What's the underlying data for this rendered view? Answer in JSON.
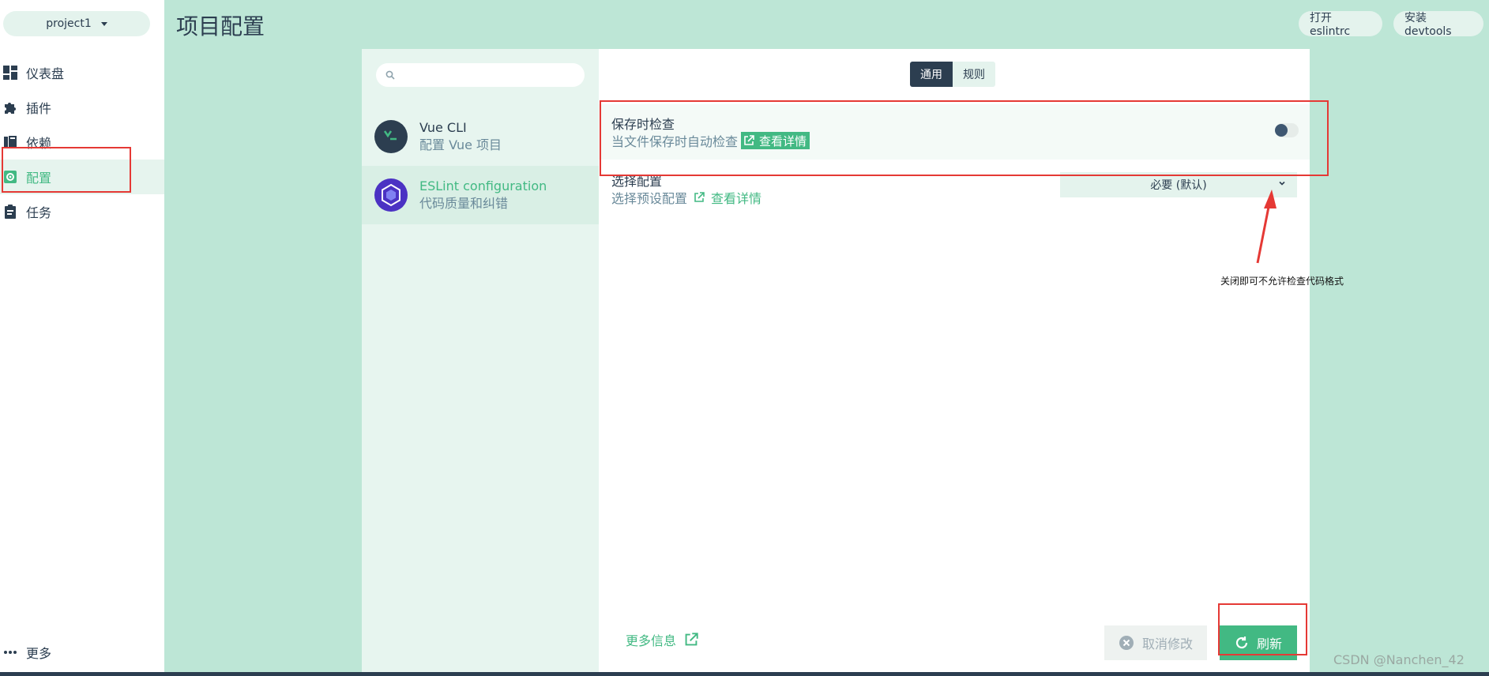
{
  "sidebar": {
    "project": "project1",
    "items": [
      {
        "label": "仪表盘",
        "icon": "dashboard-icon"
      },
      {
        "label": "插件",
        "icon": "puzzle-icon"
      },
      {
        "label": "依赖",
        "icon": "book-icon"
      },
      {
        "label": "配置",
        "icon": "gear-icon",
        "active": true
      },
      {
        "label": "任务",
        "icon": "clipboard-icon"
      }
    ],
    "more": "更多"
  },
  "header": {
    "title": "项目配置",
    "open_eslintrc": "打开 eslintrc",
    "install_devtools": "安装 devtools"
  },
  "config_list": {
    "search_placeholder": "",
    "items": [
      {
        "title": "Vue CLI",
        "subtitle": "配置 Vue 项目"
      },
      {
        "title": "ESLint configuration",
        "subtitle": "代码质量和纠错",
        "active": true
      }
    ]
  },
  "tabs": [
    {
      "label": "通用",
      "active": true
    },
    {
      "label": "规则"
    }
  ],
  "prompts": {
    "lint_on_save": {
      "name": "保存时检查",
      "description": "当文件保存时自动检查",
      "link": "查看详情",
      "enabled": false
    },
    "config": {
      "name": "选择配置",
      "description": "选择预设配置",
      "link": "查看详情",
      "value": "必要 (默认)"
    }
  },
  "footer": {
    "more_info": "更多信息",
    "cancel": "取消修改",
    "refresh": "刷新"
  },
  "annotation": {
    "note": "关闭即可不允许检查代码格式"
  },
  "watermark": "CSDN @Nanchen_42",
  "colors": {
    "accent": "#42b983",
    "dark": "#2c3e50",
    "background": "#bde6d6",
    "annotation_red": "#e53935"
  }
}
